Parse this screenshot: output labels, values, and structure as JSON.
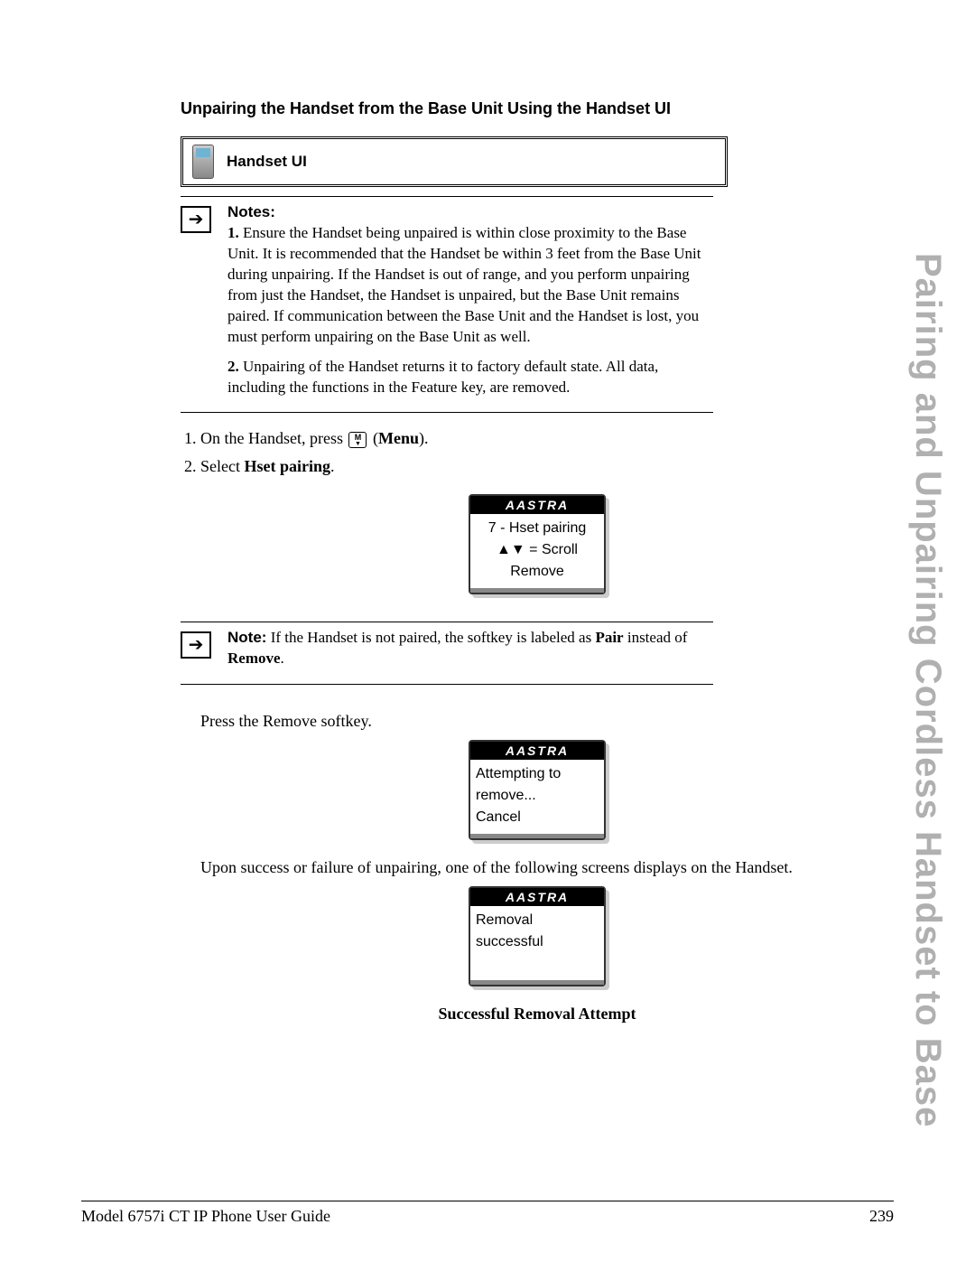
{
  "side_title": "Pairing and Unpairing Cordless Handset to Base",
  "section_title": "Unpairing the Handset from the Base Unit Using the Handset UI",
  "handset_ui_label": "Handset UI",
  "notes": {
    "label": "Notes:",
    "item1_num": "1.",
    "item1_text": "Ensure the Handset being unpaired is within close proximity to the Base Unit. It is recommended that the Handset be within 3 feet from the Base Unit during unpairing. If the Handset is out of range, and you perform unpairing from just the Handset, the Handset is unpaired, but the Base Unit remains paired. If communication between the Base Unit and the Handset is lost, you must perform unpairing on the Base Unit as well.",
    "item2_num": "2.",
    "item2_text": "Unpairing of the Handset returns it to factory default state. All data, including the functions in the Feature key, are removed."
  },
  "steps": {
    "s1_pre": "On the Handset, press ",
    "s1_post": " (",
    "s1_bold": "Menu",
    "s1_end": ").",
    "s2_pre": "Select ",
    "s2_bold": "Hset pairing",
    "s2_end": "."
  },
  "screen1": {
    "brand": "AASTRA",
    "line1": "7 - Hset pairing",
    "line2": "▲▼ = Scroll",
    "line3": "Remove"
  },
  "note_single": {
    "label": "Note:",
    "text_pre": " If the Handset is not paired, the softkey is labeled as ",
    "bold1": "Pair",
    "text_mid": " instead of ",
    "bold2": "Remove",
    "text_end": "."
  },
  "press_remove_pre": "Press the ",
  "press_remove_bold": "Remove",
  "press_remove_post": " softkey.",
  "screen2": {
    "brand": "AASTRA",
    "line1": "Attempting to",
    "line2": "remove...",
    "line3": "Cancel"
  },
  "upon_text": "Upon success or failure of unpairing, one of the following screens displays on the Handset.",
  "screen3": {
    "brand": "AASTRA",
    "line1": "Removal",
    "line2": "successful"
  },
  "caption": "Successful Removal Attempt",
  "footer_left": "Model 6757i CT IP Phone User Guide",
  "footer_right": "239"
}
